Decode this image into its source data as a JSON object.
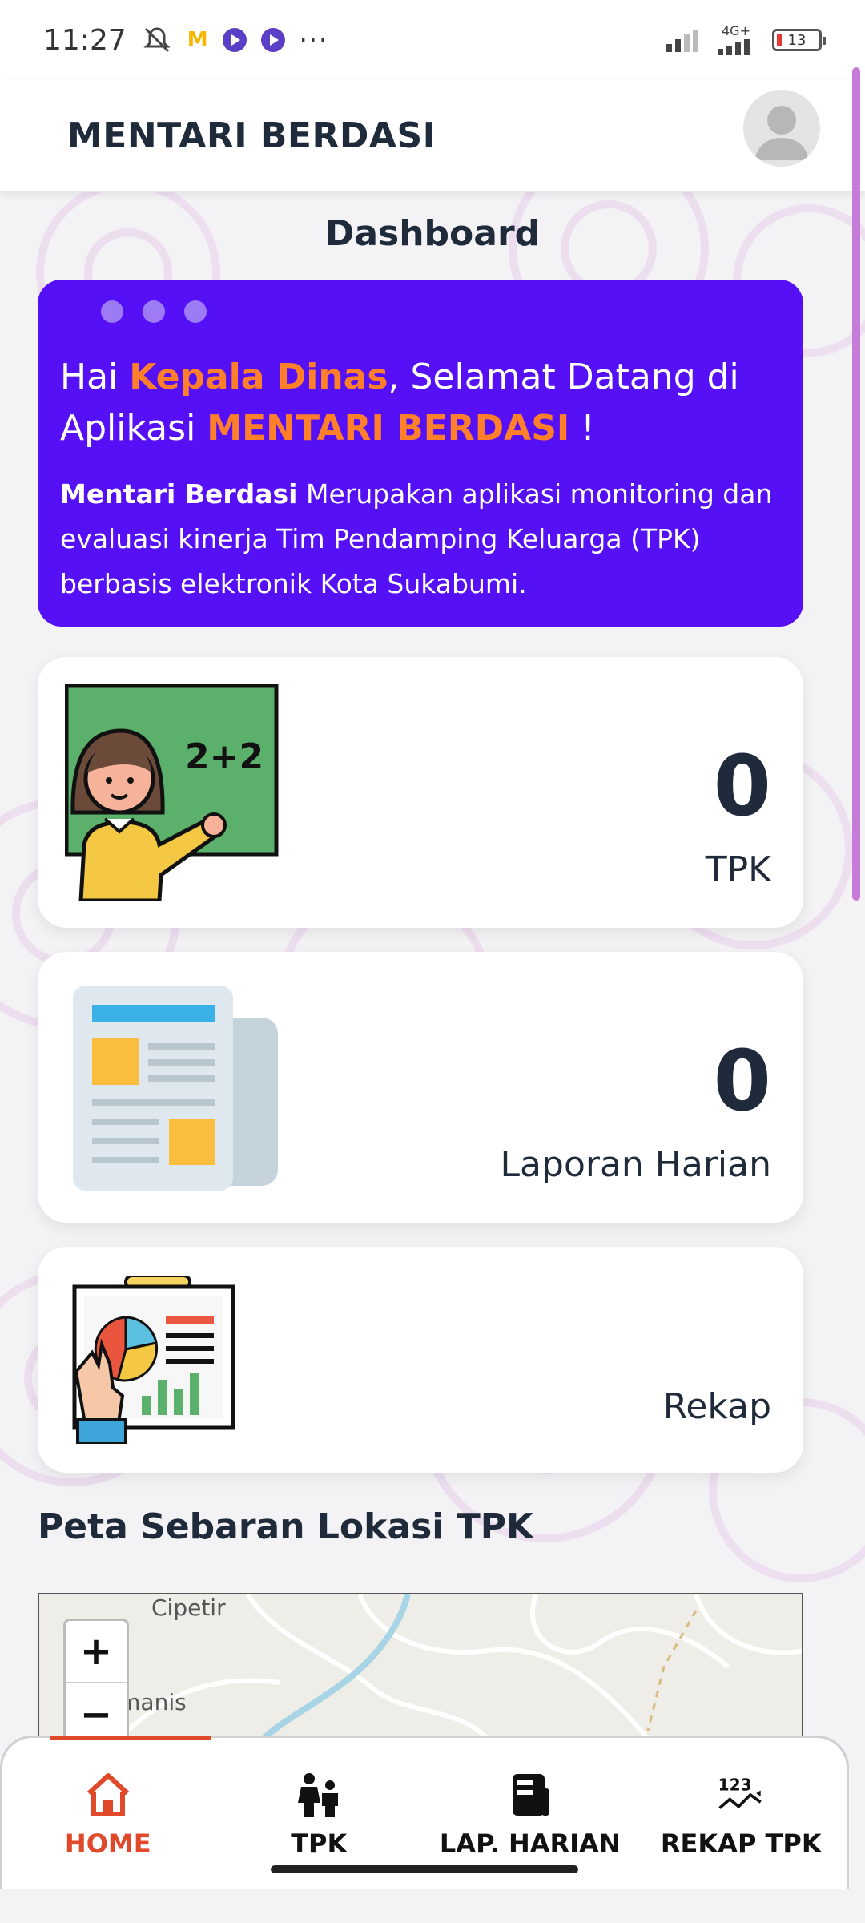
{
  "status_bar": {
    "time": "11:27",
    "network": "4G+",
    "battery": "13",
    "overflow": "···"
  },
  "header": {
    "app_title": "MENTARI BERDASI"
  },
  "page": {
    "heading": "Dashboard"
  },
  "welcome": {
    "greeting_prefix": "Hai ",
    "role": "Kepala Dinas",
    "greeting_middle": ", Selamat Datang di Aplikasi ",
    "app_name": "MENTARI BERDASI",
    "greeting_suffix": " !",
    "body_bold": "Mentari Berdasi",
    "body_rest": " Merupakan aplikasi monitoring dan evaluasi kinerja Tim Pendamping Keluarga (TPK) berbasis elektronik Kota Sukabumi."
  },
  "cards": [
    {
      "value": "0",
      "label": "TPK",
      "illustration": "teacher-board-icon"
    },
    {
      "value": "0",
      "label": "Laporan Harian",
      "illustration": "newspaper-icon"
    },
    {
      "value": "",
      "label": "Rekap",
      "illustration": "presentation-chart-icon"
    }
  ],
  "map_section": {
    "title": "Peta Sebaran Lokasi TPK",
    "labels": [
      "Cipetir",
      "amanis"
    ],
    "zoom_in": "+",
    "zoom_out": "−"
  },
  "bottom_nav": [
    {
      "label": "HOME",
      "icon": "home-icon",
      "active": true
    },
    {
      "label": "TPK",
      "icon": "people-icon",
      "active": false
    },
    {
      "label": "LAP. HARIAN",
      "icon": "report-icon",
      "active": false
    },
    {
      "label": "REKAP TPK",
      "icon": "numbers-chart-icon",
      "active": false
    }
  ],
  "colors": {
    "primary": "#5510f5",
    "accent": "#ff7f2a",
    "nav_active": "#e04a2b"
  }
}
